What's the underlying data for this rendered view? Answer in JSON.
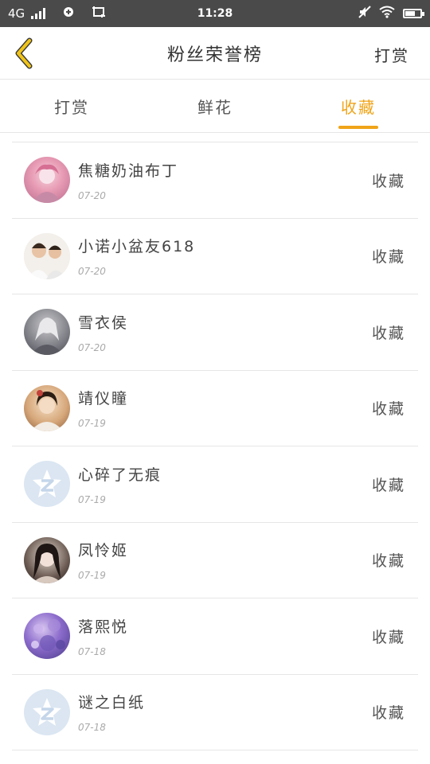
{
  "status_bar": {
    "network": "4G",
    "time": "11:28"
  },
  "header": {
    "title": "粉丝荣誉榜",
    "action_label": "打赏",
    "back_icon": "chevron-left-icon",
    "back_color": "#f0a418"
  },
  "tabs": [
    {
      "label": "打赏",
      "active": false
    },
    {
      "label": "鲜花",
      "active": false
    },
    {
      "label": "收藏",
      "active": true
    }
  ],
  "accent_color": "#f0a418",
  "fans": [
    {
      "name": "焦糖奶油布丁",
      "date": "07-20",
      "action": "收藏",
      "avatar": "photo-pink"
    },
    {
      "name": "小诺小盆友618",
      "date": "07-20",
      "action": "收藏",
      "avatar": "photo-boys"
    },
    {
      "name": "雪衣侯",
      "date": "07-20",
      "action": "收藏",
      "avatar": "photo-gray"
    },
    {
      "name": "靖仪瞳",
      "date": "07-19",
      "action": "收藏",
      "avatar": "photo-girl"
    },
    {
      "name": "心碎了无痕",
      "date": "07-19",
      "action": "收藏",
      "avatar": "default"
    },
    {
      "name": "凤怜姬",
      "date": "07-19",
      "action": "收藏",
      "avatar": "photo-dark"
    },
    {
      "name": "落熙悦",
      "date": "07-18",
      "action": "收藏",
      "avatar": "photo-purple"
    },
    {
      "name": "谜之白纸",
      "date": "07-18",
      "action": "收藏",
      "avatar": "default"
    }
  ]
}
